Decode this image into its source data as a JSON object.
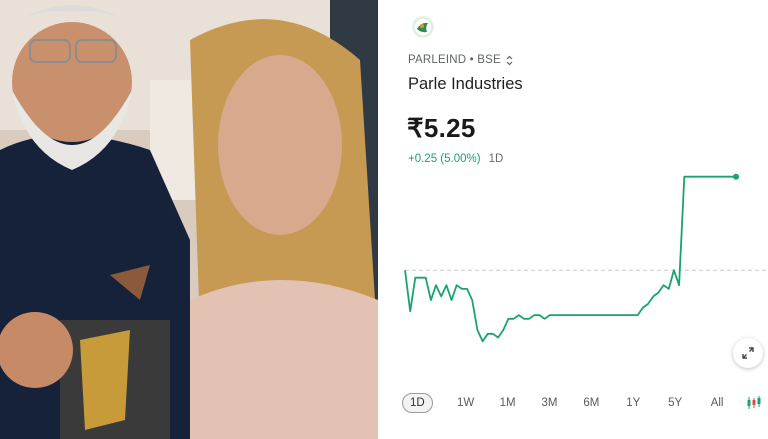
{
  "stock": {
    "ticker": "PARLEIND • BSE",
    "name": "Parle Industries",
    "price": "₹5.25",
    "change": "+0.25 (5.00%)",
    "period": "1D"
  },
  "ranges": [
    "1D",
    "1W",
    "1M",
    "3M",
    "6M",
    "1Y",
    "5Y",
    "All"
  ],
  "active_range": "1D",
  "colors": {
    "line": "#1aa36c",
    "baseline": "#c9c9c9"
  },
  "chart_data": {
    "type": "line",
    "title": "",
    "xlabel": "",
    "ylabel": "",
    "baseline": 5.0,
    "ylim": [
      4.8,
      5.3
    ],
    "x": [
      0,
      1,
      2,
      3,
      4,
      5,
      6,
      7,
      8,
      9,
      10,
      11,
      12,
      13,
      14,
      15,
      16,
      17,
      18,
      19,
      20,
      21,
      22,
      23,
      24,
      25,
      26,
      27,
      28,
      29,
      30,
      31,
      32,
      33,
      34,
      35,
      36,
      37,
      38,
      39,
      40,
      41,
      42,
      43,
      44,
      45,
      46,
      47,
      48,
      49,
      50,
      51,
      52,
      53,
      54,
      55,
      56,
      57,
      58,
      59,
      60,
      61,
      62,
      63,
      64
    ],
    "values": [
      5.0,
      4.89,
      4.98,
      4.98,
      4.98,
      4.92,
      4.96,
      4.93,
      4.96,
      4.92,
      4.96,
      4.95,
      4.95,
      4.92,
      4.84,
      4.81,
      4.83,
      4.83,
      4.82,
      4.84,
      4.87,
      4.87,
      4.88,
      4.87,
      4.87,
      4.88,
      4.88,
      4.87,
      4.88,
      4.88,
      4.88,
      4.88,
      4.88,
      4.88,
      4.88,
      4.88,
      4.88,
      4.88,
      4.88,
      4.88,
      4.88,
      4.88,
      4.88,
      4.88,
      4.88,
      4.88,
      4.9,
      4.91,
      4.93,
      4.94,
      4.96,
      4.95,
      5.0,
      4.96,
      5.25,
      5.25,
      5.25,
      5.25,
      5.25,
      5.25,
      5.25,
      5.25,
      5.25,
      5.25,
      5.25
    ]
  }
}
